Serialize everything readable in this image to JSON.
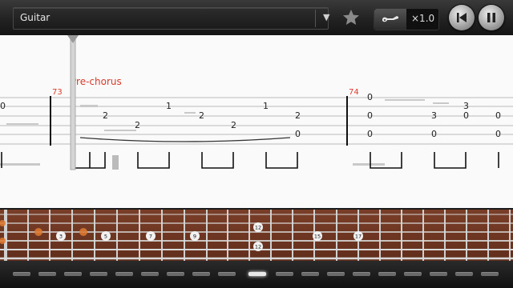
{
  "toolbar": {
    "track_name": "Guitar",
    "speed": "×1.0",
    "icons": {
      "dropdown": "triangle-down-icon",
      "favorite": "star-icon",
      "instrument": "guitar-icon",
      "rewind": "skip-to-start-icon",
      "pause": "pause-icon"
    }
  },
  "score": {
    "section_marker": "Pre-chorus",
    "measures": [
      {
        "number": "73"
      },
      {
        "number": "74"
      }
    ],
    "tab_numbers": [
      "0",
      "1",
      "2",
      "2",
      "2",
      "1",
      "2",
      "2",
      "0",
      "0",
      "0",
      "0",
      "0",
      "3",
      "0",
      "0",
      "3",
      "0"
    ]
  },
  "fretboard": {
    "fret_markers": [
      "3",
      "5",
      "7",
      "9",
      "12",
      "12",
      "15",
      "17"
    ]
  },
  "colors": {
    "accent": "#d93a2b",
    "measure_number": "#e03a2e",
    "fretboard": "#6b331f",
    "note_dot": "#e07a32"
  }
}
